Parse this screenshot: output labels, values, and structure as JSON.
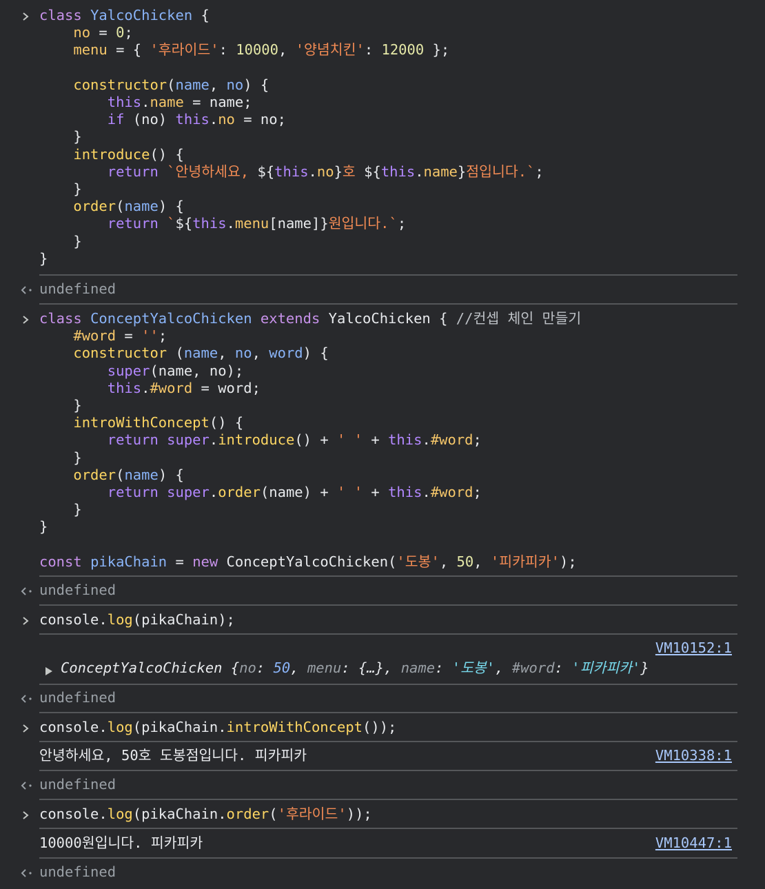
{
  "entries": [
    {
      "type": "input",
      "lines": [
        [
          [
            "k",
            "class "
          ],
          [
            "cls",
            "YalcoChicken"
          ],
          [
            "pl",
            " {"
          ]
        ],
        [
          [
            "pl",
            "    "
          ],
          [
            "prop",
            "no"
          ],
          [
            "pl",
            " = "
          ],
          [
            "num",
            "0"
          ],
          [
            "pl",
            ";"
          ]
        ],
        [
          [
            "pl",
            "    "
          ],
          [
            "prop",
            "menu"
          ],
          [
            "pl",
            " = { "
          ],
          [
            "str",
            "'후라이드'"
          ],
          [
            "pl",
            ": "
          ],
          [
            "num",
            "10000"
          ],
          [
            "pl",
            ", "
          ],
          [
            "str",
            "'양념치킨'"
          ],
          [
            "pl",
            ": "
          ],
          [
            "num",
            "12000"
          ],
          [
            "pl",
            " };"
          ]
        ],
        [
          [
            "pl",
            ""
          ]
        ],
        [
          [
            "pl",
            "    "
          ],
          [
            "fn",
            "constructor"
          ],
          [
            "pl",
            "("
          ],
          [
            "param",
            "name"
          ],
          [
            "pl",
            ", "
          ],
          [
            "param",
            "no"
          ],
          [
            "pl",
            ") {"
          ]
        ],
        [
          [
            "pl",
            "        "
          ],
          [
            "kw",
            "this"
          ],
          [
            "pl",
            "."
          ],
          [
            "prop",
            "name"
          ],
          [
            "pl",
            " = name;"
          ]
        ],
        [
          [
            "pl",
            "        "
          ],
          [
            "kw",
            "if"
          ],
          [
            "pl",
            " (no) "
          ],
          [
            "kw",
            "this"
          ],
          [
            "pl",
            "."
          ],
          [
            "prop",
            "no"
          ],
          [
            "pl",
            " = no;"
          ]
        ],
        [
          [
            "pl",
            "    }"
          ]
        ],
        [
          [
            "pl",
            "    "
          ],
          [
            "fn",
            "introduce"
          ],
          [
            "pl",
            "() {"
          ]
        ],
        [
          [
            "pl",
            "        "
          ],
          [
            "kw",
            "return"
          ],
          [
            "pl",
            " "
          ],
          [
            "tmpl",
            "`안녕하세요, "
          ],
          [
            "pl",
            "${"
          ],
          [
            "kw",
            "this"
          ],
          [
            "pl",
            "."
          ],
          [
            "prop",
            "no"
          ],
          [
            "pl",
            "}"
          ],
          [
            "tmpl",
            "호 "
          ],
          [
            "pl",
            "${"
          ],
          [
            "kw",
            "this"
          ],
          [
            "pl",
            "."
          ],
          [
            "prop",
            "name"
          ],
          [
            "pl",
            "}"
          ],
          [
            "tmpl",
            "점입니다.`"
          ],
          [
            "pl",
            ";"
          ]
        ],
        [
          [
            "pl",
            "    }"
          ]
        ],
        [
          [
            "pl",
            "    "
          ],
          [
            "fn",
            "order"
          ],
          [
            "pl",
            "("
          ],
          [
            "param",
            "name"
          ],
          [
            "pl",
            ") {"
          ]
        ],
        [
          [
            "pl",
            "        "
          ],
          [
            "kw",
            "return"
          ],
          [
            "pl",
            " "
          ],
          [
            "tmpl",
            "`"
          ],
          [
            "pl",
            "${"
          ],
          [
            "kw",
            "this"
          ],
          [
            "pl",
            "."
          ],
          [
            "prop",
            "menu"
          ],
          [
            "pl",
            "[name]}"
          ],
          [
            "tmpl",
            "원입니다.`"
          ],
          [
            "pl",
            ";"
          ]
        ],
        [
          [
            "pl",
            "    }"
          ]
        ],
        [
          [
            "pl",
            "}"
          ]
        ]
      ]
    },
    {
      "type": "result",
      "text": "undefined"
    },
    {
      "type": "input",
      "lines": [
        [
          [
            "k",
            "class "
          ],
          [
            "cls",
            "ConceptYalcoChicken"
          ],
          [
            "pl",
            " "
          ],
          [
            "k",
            "extends"
          ],
          [
            "pl",
            " YalcoChicken { "
          ],
          [
            "cm",
            "//컨셉 체인 만들기"
          ]
        ],
        [
          [
            "pl",
            "    "
          ],
          [
            "prop",
            "#word"
          ],
          [
            "pl",
            " = "
          ],
          [
            "str",
            "''"
          ],
          [
            "pl",
            ";"
          ]
        ],
        [
          [
            "pl",
            "    "
          ],
          [
            "fn",
            "constructor"
          ],
          [
            "pl",
            " ("
          ],
          [
            "param",
            "name"
          ],
          [
            "pl",
            ", "
          ],
          [
            "param",
            "no"
          ],
          [
            "pl",
            ", "
          ],
          [
            "param",
            "word"
          ],
          [
            "pl",
            ") {"
          ]
        ],
        [
          [
            "pl",
            "        "
          ],
          [
            "kw",
            "super"
          ],
          [
            "pl",
            "(name, no);"
          ]
        ],
        [
          [
            "pl",
            "        "
          ],
          [
            "kw",
            "this"
          ],
          [
            "pl",
            "."
          ],
          [
            "prop",
            "#word"
          ],
          [
            "pl",
            " = word;"
          ]
        ],
        [
          [
            "pl",
            "    }"
          ]
        ],
        [
          [
            "pl",
            "    "
          ],
          [
            "fn",
            "introWithConcept"
          ],
          [
            "pl",
            "() {"
          ]
        ],
        [
          [
            "pl",
            "        "
          ],
          [
            "kw",
            "return"
          ],
          [
            "pl",
            " "
          ],
          [
            "kw",
            "super"
          ],
          [
            "pl",
            "."
          ],
          [
            "fn",
            "introduce"
          ],
          [
            "pl",
            "() + "
          ],
          [
            "str",
            "' '"
          ],
          [
            "pl",
            " + "
          ],
          [
            "kw",
            "this"
          ],
          [
            "pl",
            "."
          ],
          [
            "prop",
            "#word"
          ],
          [
            "pl",
            ";"
          ]
        ],
        [
          [
            "pl",
            "    }"
          ]
        ],
        [
          [
            "pl",
            "    "
          ],
          [
            "fn",
            "order"
          ],
          [
            "pl",
            "("
          ],
          [
            "param",
            "name"
          ],
          [
            "pl",
            ") {"
          ]
        ],
        [
          [
            "pl",
            "        "
          ],
          [
            "kw",
            "return"
          ],
          [
            "pl",
            " "
          ],
          [
            "kw",
            "super"
          ],
          [
            "pl",
            "."
          ],
          [
            "fn",
            "order"
          ],
          [
            "pl",
            "(name) + "
          ],
          [
            "str",
            "' '"
          ],
          [
            "pl",
            " + "
          ],
          [
            "kw",
            "this"
          ],
          [
            "pl",
            "."
          ],
          [
            "prop",
            "#word"
          ],
          [
            "pl",
            ";"
          ]
        ],
        [
          [
            "pl",
            "    }"
          ]
        ],
        [
          [
            "pl",
            "}"
          ]
        ],
        [
          [
            "pl",
            ""
          ]
        ],
        [
          [
            "k",
            "const"
          ],
          [
            "pl",
            " "
          ],
          [
            "cls",
            "pikaChain"
          ],
          [
            "pl",
            " = "
          ],
          [
            "k",
            "new"
          ],
          [
            "pl",
            " ConceptYalcoChicken("
          ],
          [
            "str",
            "'도봉'"
          ],
          [
            "pl",
            ", "
          ],
          [
            "num",
            "50"
          ],
          [
            "pl",
            ", "
          ],
          [
            "str",
            "'피카피카'"
          ],
          [
            "pl",
            ");"
          ]
        ]
      ]
    },
    {
      "type": "result",
      "text": "undefined"
    },
    {
      "type": "input",
      "lines": [
        [
          [
            "pl",
            "console."
          ],
          [
            "fn",
            "log"
          ],
          [
            "pl",
            "(pikaChain);"
          ]
        ]
      ]
    },
    {
      "type": "log-object",
      "source": "VM10152:1",
      "object": [
        [
          "pl",
          "ConceptYalcoChicken {"
        ],
        [
          "key",
          "no"
        ],
        [
          "pl",
          ": "
        ],
        [
          "oval-num",
          "50"
        ],
        [
          "pl",
          ", "
        ],
        [
          "key",
          "menu"
        ],
        [
          "pl",
          ": {…}, "
        ],
        [
          "key",
          "name"
        ],
        [
          "pl",
          ": "
        ],
        [
          "oval-str",
          "'도봉'"
        ],
        [
          "pl",
          ", "
        ],
        [
          "key",
          "#word"
        ],
        [
          "pl",
          ": "
        ],
        [
          "oval-str",
          "'피카피카'"
        ],
        [
          "pl",
          "}"
        ]
      ]
    },
    {
      "type": "result",
      "text": "undefined"
    },
    {
      "type": "input",
      "lines": [
        [
          [
            "pl",
            "console."
          ],
          [
            "fn",
            "log"
          ],
          [
            "pl",
            "(pikaChain."
          ],
          [
            "fn",
            "introWithConcept"
          ],
          [
            "pl",
            "());"
          ]
        ]
      ]
    },
    {
      "type": "log",
      "text": "안녕하세요, 50호 도봉점입니다. 피카피카",
      "source": "VM10338:1"
    },
    {
      "type": "result",
      "text": "undefined"
    },
    {
      "type": "input",
      "lines": [
        [
          [
            "pl",
            "console."
          ],
          [
            "fn",
            "log"
          ],
          [
            "pl",
            "(pikaChain."
          ],
          [
            "fn",
            "order"
          ],
          [
            "pl",
            "("
          ],
          [
            "str",
            "'후라이드'"
          ],
          [
            "pl",
            "));"
          ]
        ]
      ]
    },
    {
      "type": "log",
      "text": "10000원입니다. 피카피카",
      "source": "VM10447:1"
    },
    {
      "type": "result",
      "text": "undefined"
    }
  ],
  "colors": {
    "background": "#28292c",
    "separator": "#55575a",
    "link": "#a8c7fa"
  },
  "icons": {
    "input_prompt": "chevron-right-icon",
    "result_prompt": "return-arrow-icon",
    "expand": "triangle-right-icon"
  }
}
